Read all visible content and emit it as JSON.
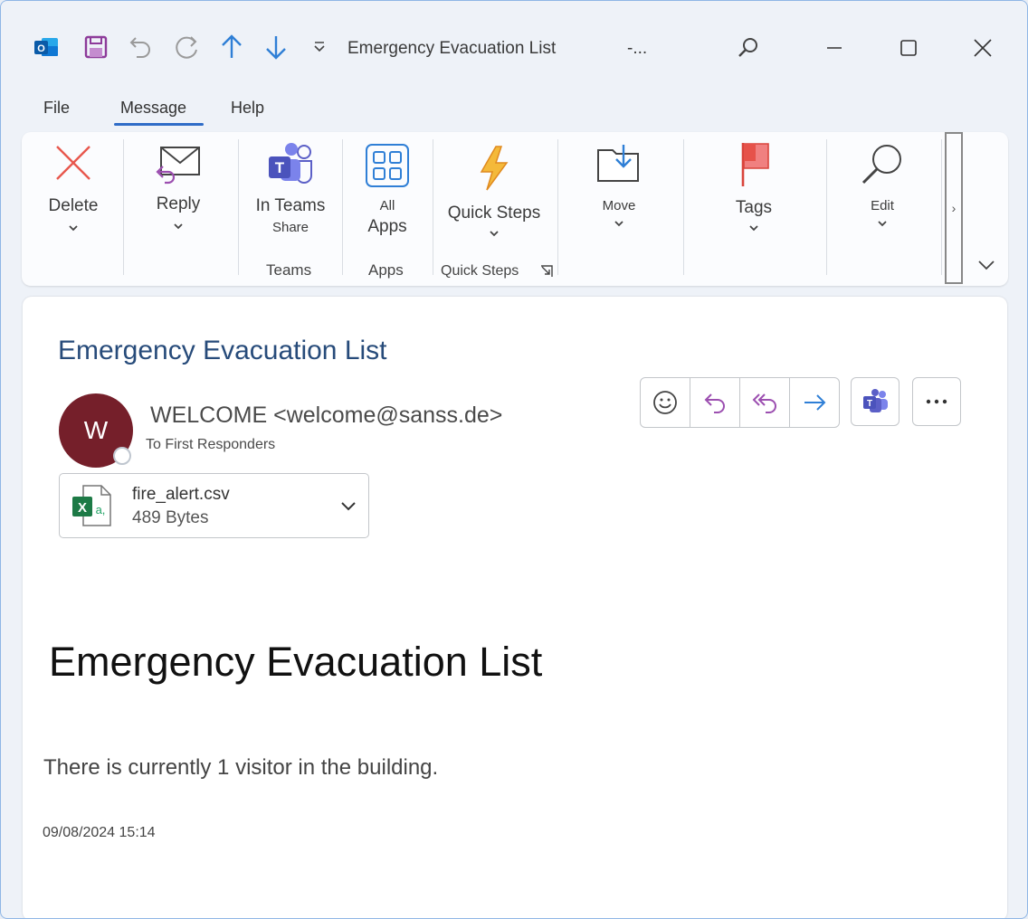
{
  "window": {
    "title": "Emergency Evacuation List",
    "title_suffix": "-..."
  },
  "quick_access": [
    "outlook-icon",
    "save-icon",
    "undo-icon",
    "redo-icon",
    "up-arrow-icon",
    "down-arrow-icon",
    "customize-icon"
  ],
  "menu": {
    "tabs": [
      {
        "label": "File",
        "active": false
      },
      {
        "label": "Message",
        "active": true
      },
      {
        "label": "Help",
        "active": false
      }
    ]
  },
  "ribbon": {
    "delete": "Delete",
    "reply": "Reply",
    "in_teams": "In Teams",
    "share": "Share",
    "teams_group": "Teams",
    "all": "All",
    "apps": "Apps",
    "apps_group": "Apps",
    "quick_steps": "Quick Steps",
    "quick_steps_group": "Quick Steps",
    "move": "Move",
    "tags": "Tags",
    "edit": "Edit",
    "overflow": "›"
  },
  "message": {
    "subject": "Emergency Evacuation List",
    "avatar_initial": "W",
    "sender": "WELCOME <welcome@sanss.de>",
    "to": "To First Responders",
    "attachment": {
      "name": "fire_alert.csv",
      "size": "489 Bytes"
    },
    "body_heading": "Emergency Evacuation List",
    "body_text": "There is currently 1 visitor in the building.",
    "body_date": "09/08/2024 15:14"
  },
  "colors": {
    "accent": "#2f6cc7",
    "subject": "#274b7a",
    "avatar": "#751f2a",
    "teams": "#5b5fc7",
    "excel": "#1d7a46"
  }
}
